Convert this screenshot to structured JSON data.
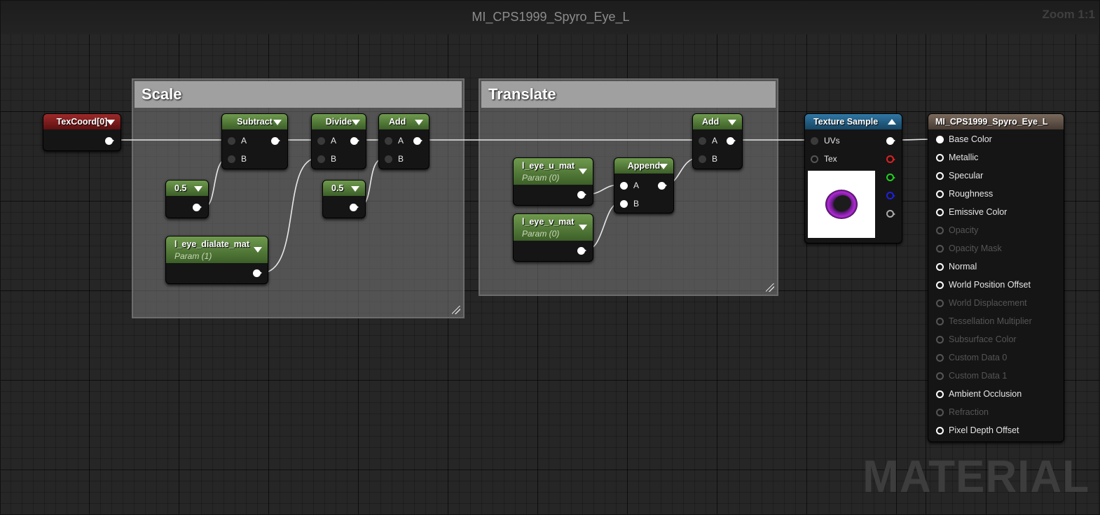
{
  "graph": {
    "title": "MI_CPS1999_Spyro_Eye_L",
    "zoom": "Zoom 1:1",
    "watermark": "MATERIAL"
  },
  "comments": {
    "scale": "Scale",
    "translate": "Translate"
  },
  "nodes": {
    "texcoord": {
      "title": "TexCoord[0]"
    },
    "subtract": {
      "title": "Subtract",
      "pin_a": "A",
      "pin_b": "B"
    },
    "divide": {
      "title": "Divide",
      "pin_a": "A",
      "pin_b": "B"
    },
    "add_scale": {
      "title": "Add",
      "pin_a": "A",
      "pin_b": "B"
    },
    "const_05_a": {
      "title": "0.5"
    },
    "const_05_b": {
      "title": "0.5"
    },
    "dialate_param": {
      "title": "l_eye_dialate_mat",
      "subtitle": "Param (1)"
    },
    "eye_u_param": {
      "title": "l_eye_u_mat",
      "subtitle": "Param (0)"
    },
    "eye_v_param": {
      "title": "l_eye_v_mat",
      "subtitle": "Param (0)"
    },
    "append": {
      "title": "Append",
      "pin_a": "A",
      "pin_b": "B"
    },
    "add_translate": {
      "title": "Add",
      "pin_a": "A",
      "pin_b": "B"
    },
    "texture_sample": {
      "title": "Texture Sample",
      "pin_uvs": "UVs",
      "pin_tex": "Tex"
    },
    "result": {
      "title": "MI_CPS1999_Spyro_Eye_L",
      "pins": [
        {
          "label": "Base Color",
          "active": true
        },
        {
          "label": "Metallic",
          "active": true
        },
        {
          "label": "Specular",
          "active": true
        },
        {
          "label": "Roughness",
          "active": true
        },
        {
          "label": "Emissive Color",
          "active": true
        },
        {
          "label": "Opacity",
          "active": false
        },
        {
          "label": "Opacity Mask",
          "active": false
        },
        {
          "label": "Normal",
          "active": true
        },
        {
          "label": "World Position Offset",
          "active": true
        },
        {
          "label": "World Displacement",
          "active": false
        },
        {
          "label": "Tessellation Multiplier",
          "active": false
        },
        {
          "label": "Subsurface Color",
          "active": false
        },
        {
          "label": "Custom Data 0",
          "active": false
        },
        {
          "label": "Custom Data 1",
          "active": false
        },
        {
          "label": "Ambient Occlusion",
          "active": true
        },
        {
          "label": "Refraction",
          "active": false
        },
        {
          "label": "Pixel Depth Offset",
          "active": true
        }
      ]
    }
  },
  "colors": {
    "background": "#262626",
    "param_header": "#5a8a3c",
    "texcoord_header": "#8a1e1e",
    "texture_header": "#1f5f8a",
    "result_header": "#6b5a4c",
    "eye_preview": "#8a1fa8"
  }
}
